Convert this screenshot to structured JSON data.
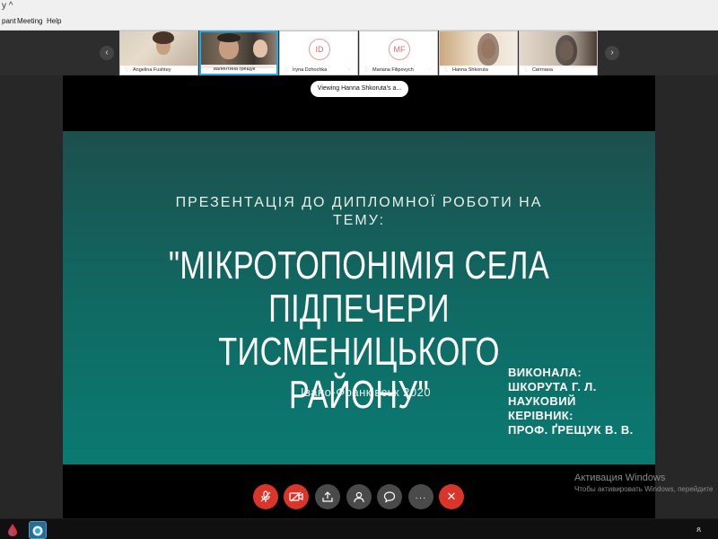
{
  "titlebar": {
    "caret": "y ^"
  },
  "menu": {
    "items": [
      "pant",
      "Meeting",
      "Help"
    ]
  },
  "participants": [
    {
      "name": "Angelina Fushtey",
      "muted": false
    },
    {
      "name": "валентина грещук",
      "muted": false
    },
    {
      "name": "Iryna Dzhochka",
      "initials": "ID",
      "muted": true
    },
    {
      "name": "Mariana Filipovych",
      "initials": "MF",
      "muted": true
    },
    {
      "name": "Hanna Shkoruta",
      "muted": false
    },
    {
      "name": "Світлана",
      "muted": false
    }
  ],
  "viewing_pill": "Viewing Hanna Shkoruta's a...",
  "slide": {
    "subtitle": "ПРЕЗЕНТАЦІЯ ДО ДИПЛОМНОЇ РОБОТИ НА ТЕМУ:",
    "title": "\"МІКРОТОПОНІМІЯ СЕЛА ПІДПЕЧЕРИ ТИСМЕНИЦЬКОГО РАЙОНУ\"",
    "city_year": "Івано-Франківськ 2020",
    "author_lines": [
      "ВИКОНАЛА:",
      "ШКОРУТА Г. Л.",
      "НАУКОВИЙ",
      "КЕРІВНИК:",
      "ПРОФ. ҐРЕЩУК В. В."
    ]
  },
  "watermark": {
    "line1": "Активация Windows",
    "line2": "Чтобы активировать Windows, перейдите"
  },
  "controls": {
    "accent_red": "#d9352a",
    "items": [
      "mute-mic",
      "stop-video",
      "share",
      "participants",
      "chat",
      "more",
      "leave"
    ]
  },
  "taskbar": {
    "sys_text": "ጸ"
  }
}
